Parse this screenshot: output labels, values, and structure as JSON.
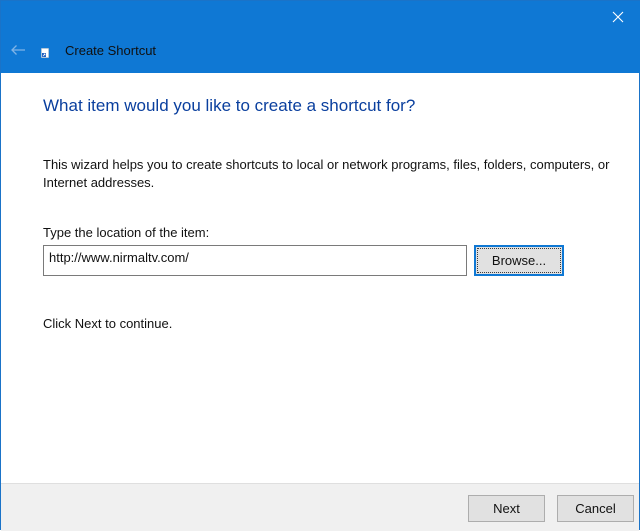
{
  "window": {
    "title": "Create Shortcut",
    "close_icon": "close-icon",
    "back_icon": "back-arrow-icon",
    "app_icon": "shortcut-icon"
  },
  "main": {
    "heading": "What item would you like to create a shortcut for?",
    "description": "This wizard helps you to create shortcuts to local or network programs, files, folders, computers, or Internet addresses.",
    "location_label": "Type the location of the item:",
    "location_value": "http://www.nirmaltv.com/",
    "browse_label": "Browse...",
    "continue_text": "Click Next to continue."
  },
  "footer": {
    "next_label": "Next",
    "cancel_label": "Cancel"
  },
  "colors": {
    "titlebar": "#0f78d4",
    "heading": "#0a3f9e",
    "footer": "#f0f0f0",
    "button": "#e1e1e1",
    "focus_border": "#0f78d4"
  }
}
